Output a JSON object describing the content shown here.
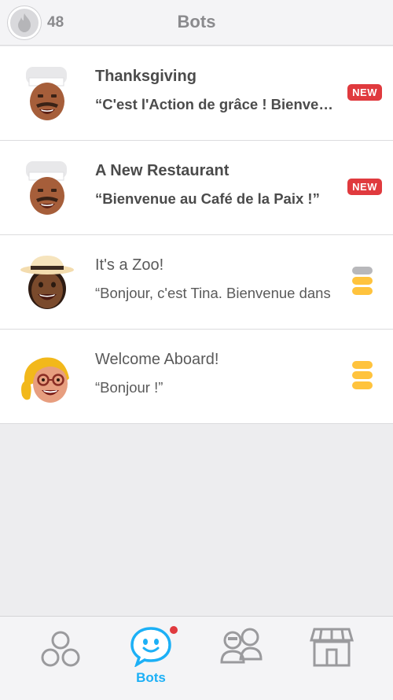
{
  "header": {
    "streak_count": "48",
    "title": "Bots",
    "streak_icon": "flame-icon"
  },
  "bots": [
    {
      "title": "Thanksgiving",
      "subtitle": "“C'est l'Action de grâce ! Bienvenue",
      "badge": "NEW",
      "avatar": "chef-avatar"
    },
    {
      "title": "A New Restaurant",
      "subtitle": "“Bienvenue au Café de la Paix !”",
      "badge": "NEW",
      "avatar": "chef-avatar"
    },
    {
      "title": "It's a Zoo!",
      "subtitle": "“Bonjour, c'est Tina. Bienvenue dans",
      "status_icon": "stack-partial-icon",
      "avatar": "safari-avatar"
    },
    {
      "title": "Welcome Aboard!",
      "subtitle": "“Bonjour !”",
      "status_icon": "stack-full-icon",
      "avatar": "blonde-avatar"
    }
  ],
  "tabbar": {
    "active_label": "Bots",
    "tabs": [
      "learn-tab",
      "bots-tab",
      "clubs-tab",
      "shop-tab"
    ]
  },
  "colors": {
    "accent_blue": "#1cb0f6",
    "badge_red": "#e03a3e",
    "gold": "#ffc33d"
  }
}
